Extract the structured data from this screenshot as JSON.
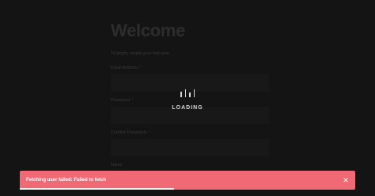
{
  "form": {
    "title": "Welcome",
    "subtitle": "To begin, create your first user.",
    "fields": [
      {
        "label": "Email Address",
        "required_mark": "*",
        "value": ""
      },
      {
        "label": "Password",
        "required_mark": "*",
        "value": ""
      },
      {
        "label": "Confirm Password",
        "required_mark": "*",
        "value": ""
      },
      {
        "label": "Name",
        "required_mark": "",
        "value": ""
      }
    ]
  },
  "loader": {
    "text": "LOADING"
  },
  "toast": {
    "message": "Fetching user failed: Failed to fetch",
    "close_icon": "close-icon",
    "progress_fraction": 0.46,
    "color": "#f06a76"
  }
}
